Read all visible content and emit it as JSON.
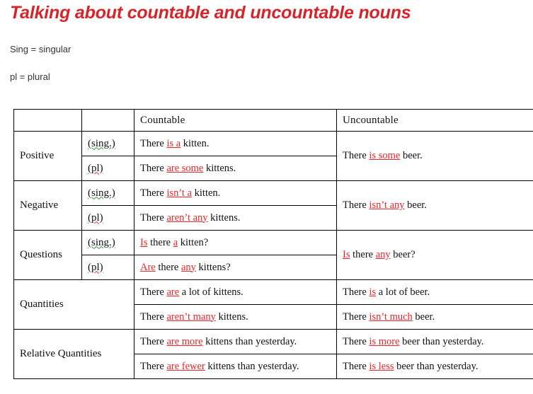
{
  "page": {
    "title": "Talking about countable and uncountable nouns",
    "title_color": "#d8232a",
    "legend": {
      "sing": "Sing = singular",
      "pl": "pl = plural"
    }
  },
  "table": {
    "headers": {
      "category": "",
      "number": "",
      "countable": "Countable",
      "uncountable": "Uncountable"
    },
    "highlight_color": "#e8262b",
    "rows": [
      {
        "category": "Positive",
        "number_sing": "(sing.)",
        "number_pl": "(pl)",
        "countable_sing": {
          "pre": "There ",
          "hl": "is a",
          "post": " kitten."
        },
        "countable_pl": {
          "pre": "There ",
          "hl": "are some",
          "post": " kittens."
        },
        "uncountable": {
          "pre": "There ",
          "hl": "is some",
          "post": " beer."
        }
      },
      {
        "category": "Negative",
        "number_sing": "(sing.)",
        "number_pl": "(pl)",
        "countable_sing": {
          "pre": "There ",
          "hl": "isn’t a",
          "post": " kitten."
        },
        "countable_pl": {
          "pre": "There ",
          "hl": "aren’t any",
          "post": " kittens."
        },
        "uncountable": {
          "pre": "There ",
          "hl": "isn’t any",
          "post": " beer."
        }
      },
      {
        "category": "Questions",
        "number_sing": "(sing.)",
        "number_pl": "(pl)",
        "countable_sing": {
          "pre": "",
          "hl": "Is",
          "mid": " there ",
          "hl2": "a",
          "post": " kitten?"
        },
        "countable_pl": {
          "pre": "",
          "hl": "Are",
          "mid": " there ",
          "hl2": "any",
          "post": " kittens?"
        },
        "uncountable": {
          "pre": "",
          "hl": "Is",
          "mid": " there ",
          "hl2": "any",
          "post": " beer?"
        }
      },
      {
        "category": "Quantities",
        "countable_sing": {
          "pre": "There ",
          "hl": "are",
          "post": " a lot of kittens."
        },
        "countable_pl": {
          "pre": "There ",
          "hl": "aren’t many",
          "post": " kittens."
        },
        "uncountable_sing": {
          "pre": "There ",
          "hl": "is",
          "post": " a lot of beer."
        },
        "uncountable_pl": {
          "pre": "There ",
          "hl": "isn’t much",
          "post": " beer."
        }
      },
      {
        "category": "Relative Quantities",
        "countable_sing": {
          "pre": "There ",
          "hl": "are more",
          "post": " kittens than yesterday."
        },
        "countable_pl": {
          "pre": "There ",
          "hl": "are fewer",
          "post": " kittens than yesterday."
        },
        "uncountable_sing": {
          "pre": "There ",
          "hl": "is more",
          "post": " beer than yesterday."
        },
        "uncountable_pl": {
          "pre": "There ",
          "hl": "is less",
          "post": " beer than yesterday."
        }
      }
    ]
  }
}
